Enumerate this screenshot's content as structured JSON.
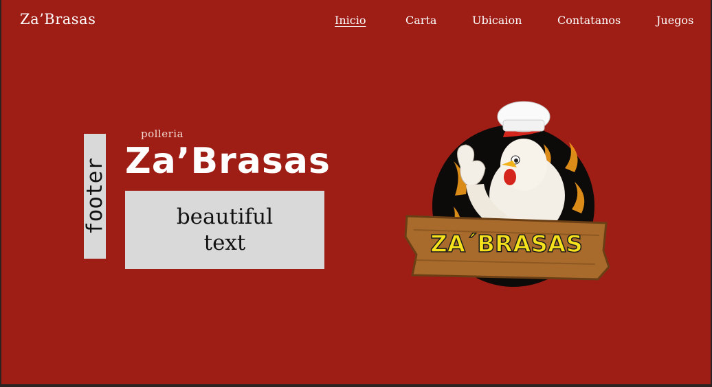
{
  "brand": "Za’Brasas",
  "nav": [
    "Inicio",
    "Carta",
    "Ubicaion",
    "Contatanos",
    "Juegos"
  ],
  "hero": {
    "subtitle": "polleria",
    "title": "Za’Brasas",
    "footer_tag": "footer",
    "text_box": "beautiful text"
  },
  "logo": {
    "text": "ZA´BRASAS"
  },
  "colors": {
    "background": "#9e1e16",
    "nav_text": "#ffffff",
    "panel": "#d9d9d9"
  }
}
